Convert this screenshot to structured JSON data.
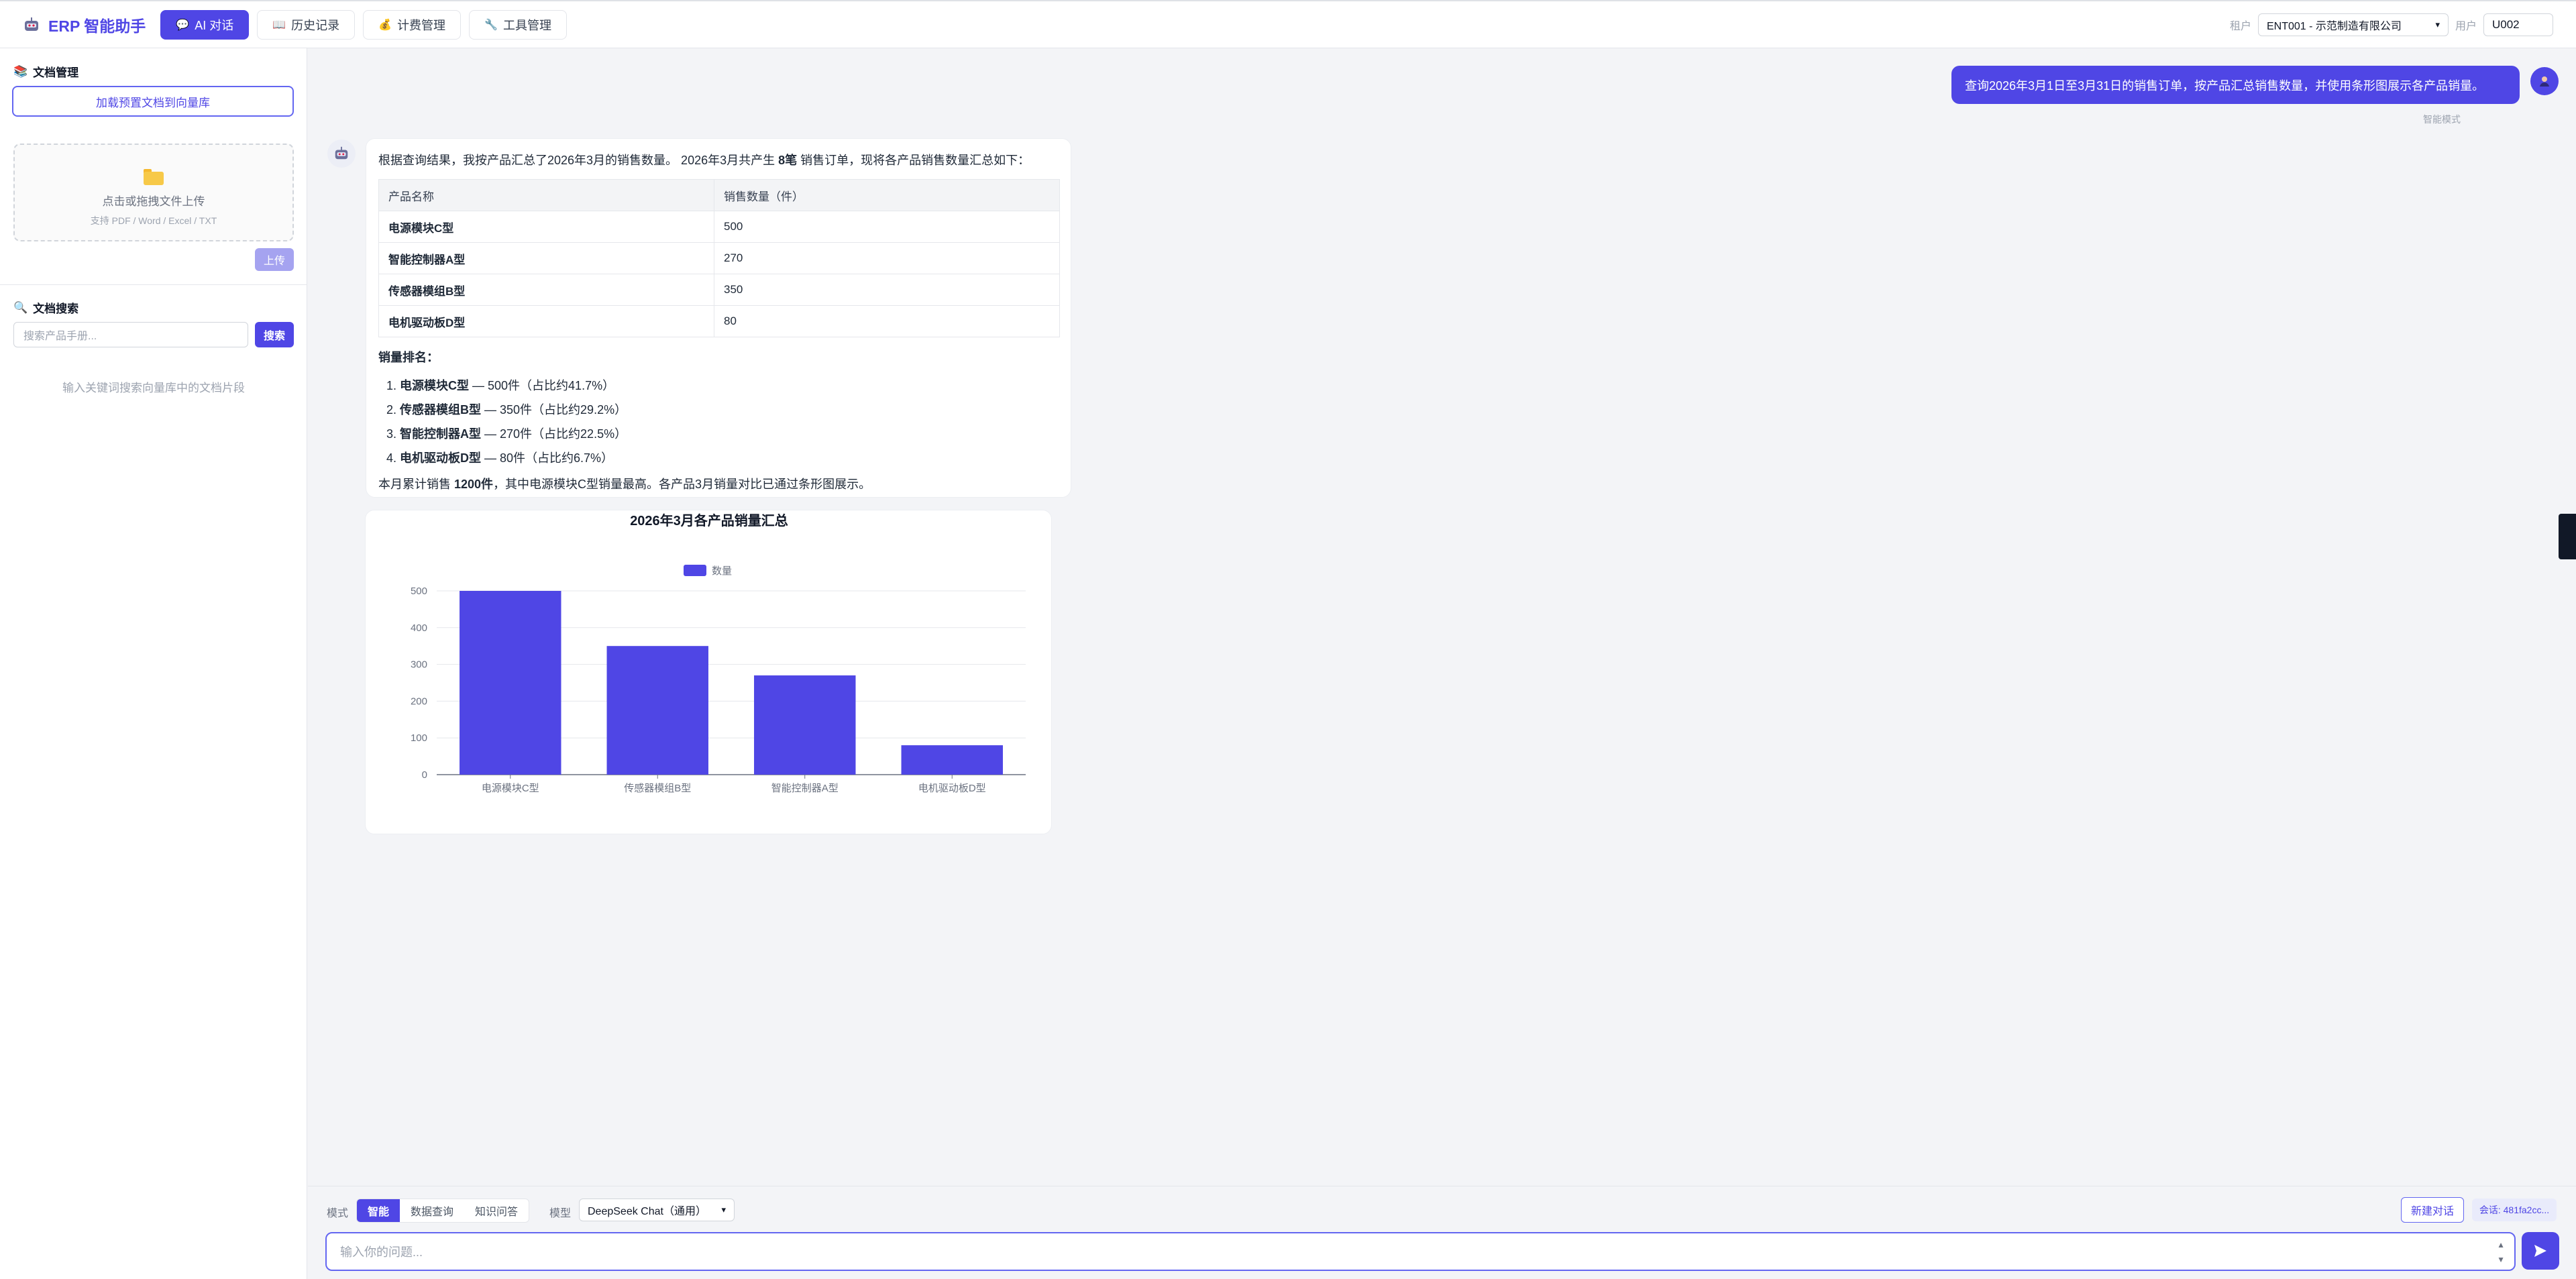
{
  "header": {
    "brand": "ERP 智能助手",
    "tabs": [
      {
        "label": "AI 对话",
        "icon": "chat-bubble-icon",
        "active": true
      },
      {
        "label": "历史记录",
        "icon": "book-icon",
        "active": false
      },
      {
        "label": "计费管理",
        "icon": "money-bag-icon",
        "active": false
      },
      {
        "label": "工具管理",
        "icon": "wrench-icon",
        "active": false
      }
    ],
    "tenant_label": "租户",
    "tenant_value": "ENT001 - 示范制造有限公司",
    "user_label": "用户",
    "user_value": "U002"
  },
  "sidebar": {
    "doc_title": "文档管理",
    "load_button": "加载预置文档到向量库",
    "upload_main": "点击或拖拽文件上传",
    "upload_sub": "支持 PDF / Word / Excel / TXT",
    "upload_button": "上传",
    "search_title": "文档搜索",
    "search_placeholder": "搜索产品手册...",
    "search_button": "搜索",
    "search_hint": "输入关键词搜索向量库中的文档片段"
  },
  "chat": {
    "user_message": "查询2026年3月1日至3月31日的销售订单，按产品汇总销售数量，并使用条形图展示各产品销量。",
    "mode_note": "智能模式",
    "bot_intro_pre": "根据查询结果，我按产品汇总了2026年3月的销售数量。 2026年3月共产生",
    "bot_intro_count": "8笔",
    "bot_intro_post": "销售订单，现将各产品销售数量汇总如下：",
    "table_headers": [
      "产品名称",
      "销售数量（件）"
    ],
    "table_rows": [
      [
        "电源模块C型",
        "500"
      ],
      [
        "智能控制器A型",
        "270"
      ],
      [
        "传感器模组B型",
        "350"
      ],
      [
        "电机驱动板D型",
        "80"
      ]
    ],
    "rank_title": "销量排名：",
    "ranking": [
      {
        "name": "电源模块C型",
        "detail": "— 500件（占比约41.7%）"
      },
      {
        "name": "传感器模组B型",
        "detail": "— 350件（占比约29.2%）"
      },
      {
        "name": "智能控制器A型",
        "detail": "— 270件（占比约22.5%）"
      },
      {
        "name": "电机驱动板D型",
        "detail": "— 80件（占比约6.7%）"
      }
    ],
    "summary_pre": "本月累计销售",
    "summary_total": "1200件",
    "summary_post": "，其中电源模块C型销量最高。各产品3月销量对比已通过条形图展示。"
  },
  "chart_data": {
    "type": "bar",
    "title": "2026年3月各产品销量汇总",
    "categories": [
      "电源模块C型",
      "传感器模组B型",
      "智能控制器A型",
      "电机驱动板D型"
    ],
    "series": [
      {
        "name": "数量",
        "values": [
          500,
          350,
          270,
          80
        ]
      }
    ],
    "ylim": [
      0,
      500
    ],
    "yticks": [
      0,
      100,
      200,
      300,
      400,
      500
    ],
    "grid": true,
    "legend": "top-center",
    "color": "#4f46e5"
  },
  "bottom": {
    "mode_label": "模式",
    "modes": [
      "智能",
      "数据查询",
      "知识问答"
    ],
    "active_mode": "智能",
    "model_label": "模型",
    "model_value": "DeepSeek Chat（通用）",
    "new_chat": "新建对话",
    "session": "会话: 481fa2cc...",
    "input_placeholder": "输入你的问题..."
  },
  "colors": {
    "accent": "#4f46e5",
    "background": "#f3f4f7"
  }
}
